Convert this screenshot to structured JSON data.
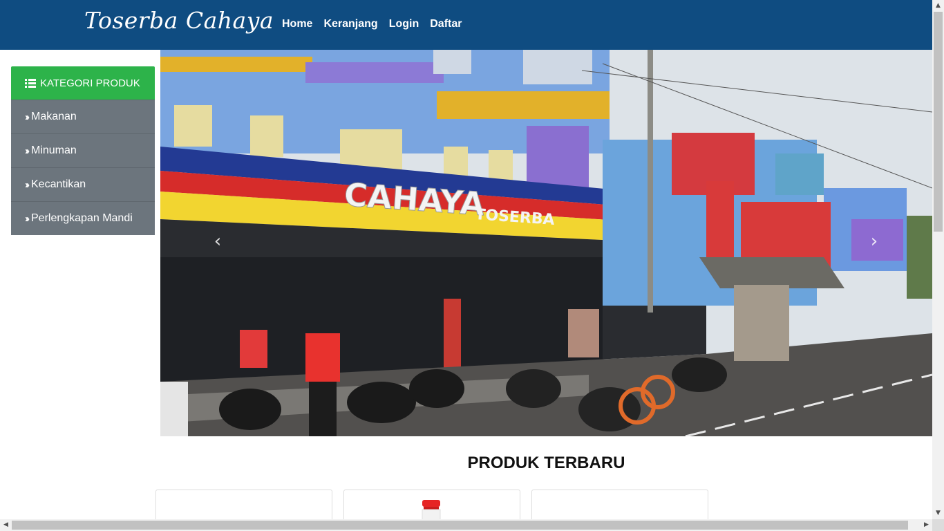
{
  "brand": "Toserba Cahaya",
  "nav": [
    {
      "label": "Home"
    },
    {
      "label": "Keranjang"
    },
    {
      "label": "Login"
    },
    {
      "label": "Daftar"
    }
  ],
  "sidebar": {
    "header": "KATEGORI PRODUK",
    "header_icon": "list-icon",
    "items": [
      {
        "label": "Makanan",
        "icon": "angle-double-right-icon"
      },
      {
        "label": "Minuman",
        "icon": "angle-double-right-icon"
      },
      {
        "label": "Kecantikan",
        "icon": "angle-double-right-icon"
      },
      {
        "label": "Perlengkapan Mandi",
        "icon": "angle-double-right-icon"
      }
    ]
  },
  "carousel": {
    "storefront_sign": "CAHAYA",
    "storefront_sign_small": "TOSERBA",
    "prev_icon": "chevron-left-icon",
    "next_icon": "chevron-right-icon"
  },
  "products": {
    "title": "PRODUK TERBARU"
  },
  "colors": {
    "navbar": "#0f4c81",
    "sidebar_header": "#2db34a",
    "sidebar_item": "#6c757d"
  }
}
